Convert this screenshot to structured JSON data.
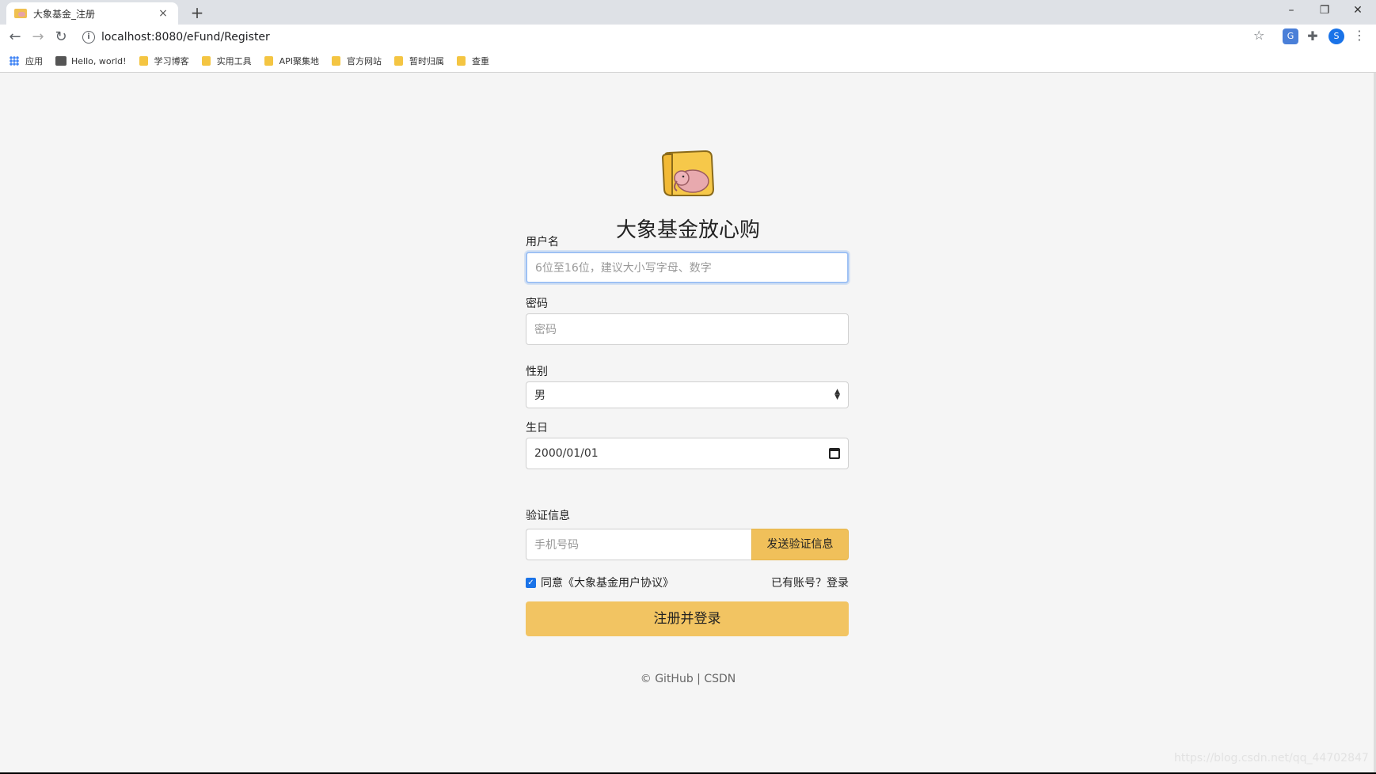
{
  "browser": {
    "tab_title": "大象基金_注册",
    "tab_close": "×",
    "new_tab": "+",
    "url": "localhost:8080/eFund/Register",
    "window": {
      "minimize": "–",
      "restore": "❐",
      "close": "✕"
    },
    "nav": {
      "back": "←",
      "forward": "→",
      "reload": "↻",
      "info": "i",
      "star": "☆",
      "menu": "⋮"
    },
    "extensions": {
      "translate": "G",
      "puzzle": "✚",
      "avatar": "S"
    },
    "bookmarks": [
      {
        "label": "应用",
        "icon": "apps-icon"
      },
      {
        "label": "Hello, world!",
        "icon": "site-icon"
      },
      {
        "label": "学习博客",
        "icon": "folder-icon"
      },
      {
        "label": "实用工具",
        "icon": "folder-icon"
      },
      {
        "label": "API聚集地",
        "icon": "folder-icon"
      },
      {
        "label": "官方网站",
        "icon": "folder-icon"
      },
      {
        "label": "暂时归属",
        "icon": "folder-icon"
      },
      {
        "label": "查重",
        "icon": "folder-icon"
      }
    ]
  },
  "page": {
    "brand": "大象基金放心购",
    "username": {
      "label": "用户名",
      "placeholder": "6位至16位，建议大小写字母、数字"
    },
    "password": {
      "label": "密码",
      "placeholder": "密码"
    },
    "gender": {
      "label": "性别",
      "selected": "男"
    },
    "birthday": {
      "label": "生日",
      "value": "2000/01/01"
    },
    "verification": {
      "label": "验证信息",
      "placeholder": "手机号码",
      "send_button": "发送验证信息"
    },
    "agreement": "同意《大象基金用户协议》",
    "has_account": "已有账号？登录",
    "submit": "注册并登录",
    "footer": "© GitHub | CSDN",
    "watermark": "https://blog.csdn.net/qq_44702847"
  },
  "colors": {
    "accent": "#f2c462",
    "page_bg": "#f5f5f5",
    "focus_border": "#9ec1f4",
    "checkbox": "#1a73e8"
  }
}
